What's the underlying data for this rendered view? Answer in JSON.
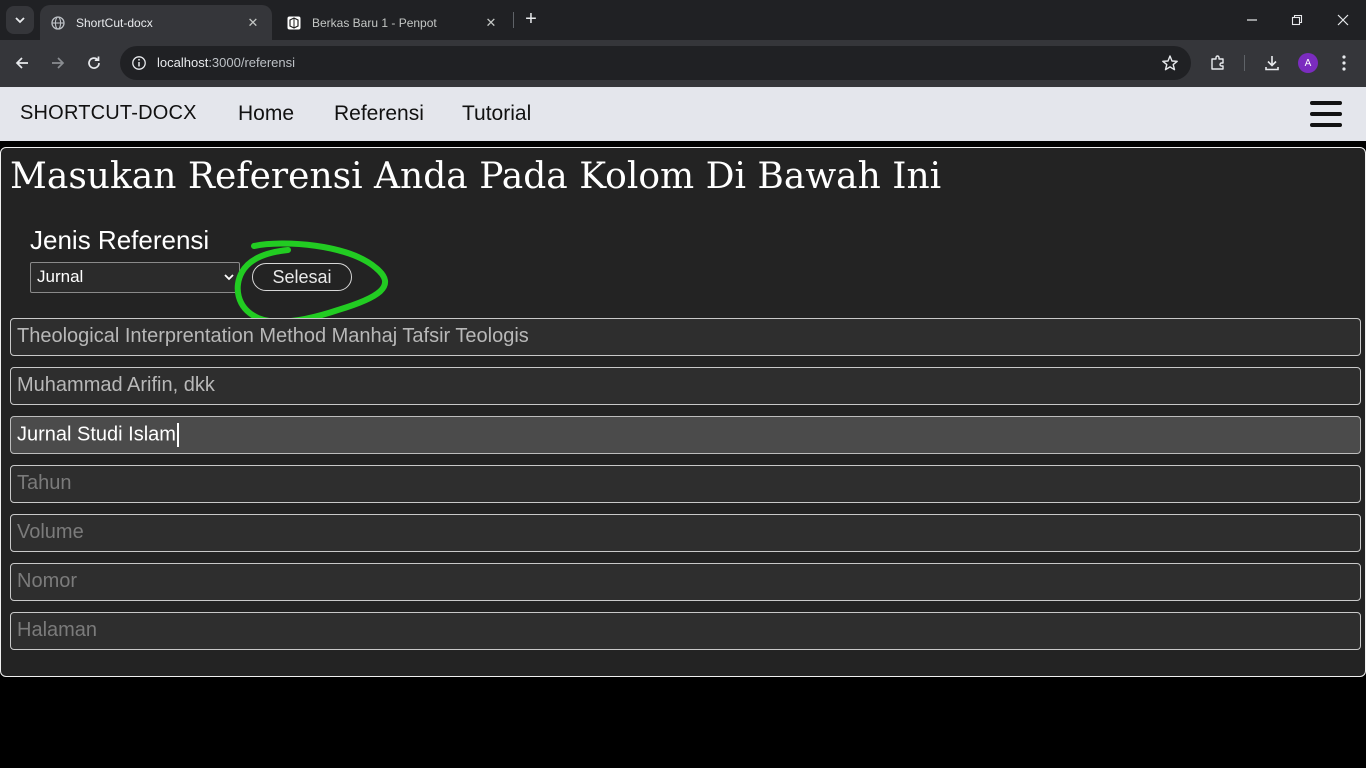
{
  "browser": {
    "tabs": [
      {
        "title": "ShortCut-docx",
        "active": true
      },
      {
        "title": "Berkas Baru 1 - Penpot",
        "active": false
      }
    ],
    "url_host": "localhost",
    "url_path": ":3000/referensi",
    "profile_initial": "A"
  },
  "navbar": {
    "brand": "SHORTCUT-DOCX",
    "links": [
      "Home",
      "Referensi",
      "Tutorial"
    ]
  },
  "form": {
    "title": "Masukan Referensi Anda Pada Kolom Di Bawah Ini",
    "type_label": "Jenis Referensi",
    "type_selected": "Jurnal",
    "submit_label": "Selesai",
    "fields": [
      {
        "value": "Theological Interprentation Method Manhaj Tafsir Teologis",
        "placeholder": ""
      },
      {
        "value": "Muhammad Arifin, dkk",
        "placeholder": ""
      },
      {
        "value": "Jurnal Studi Islam",
        "placeholder": "",
        "focused": true
      },
      {
        "value": "",
        "placeholder": "Tahun"
      },
      {
        "value": "",
        "placeholder": "Volume"
      },
      {
        "value": "",
        "placeholder": "Nomor"
      },
      {
        "value": "",
        "placeholder": "Halaman"
      }
    ]
  },
  "colors": {
    "annotation": "#22cc22",
    "navbar_bg": "#e4e6ec",
    "panel_bg": "#232323"
  }
}
